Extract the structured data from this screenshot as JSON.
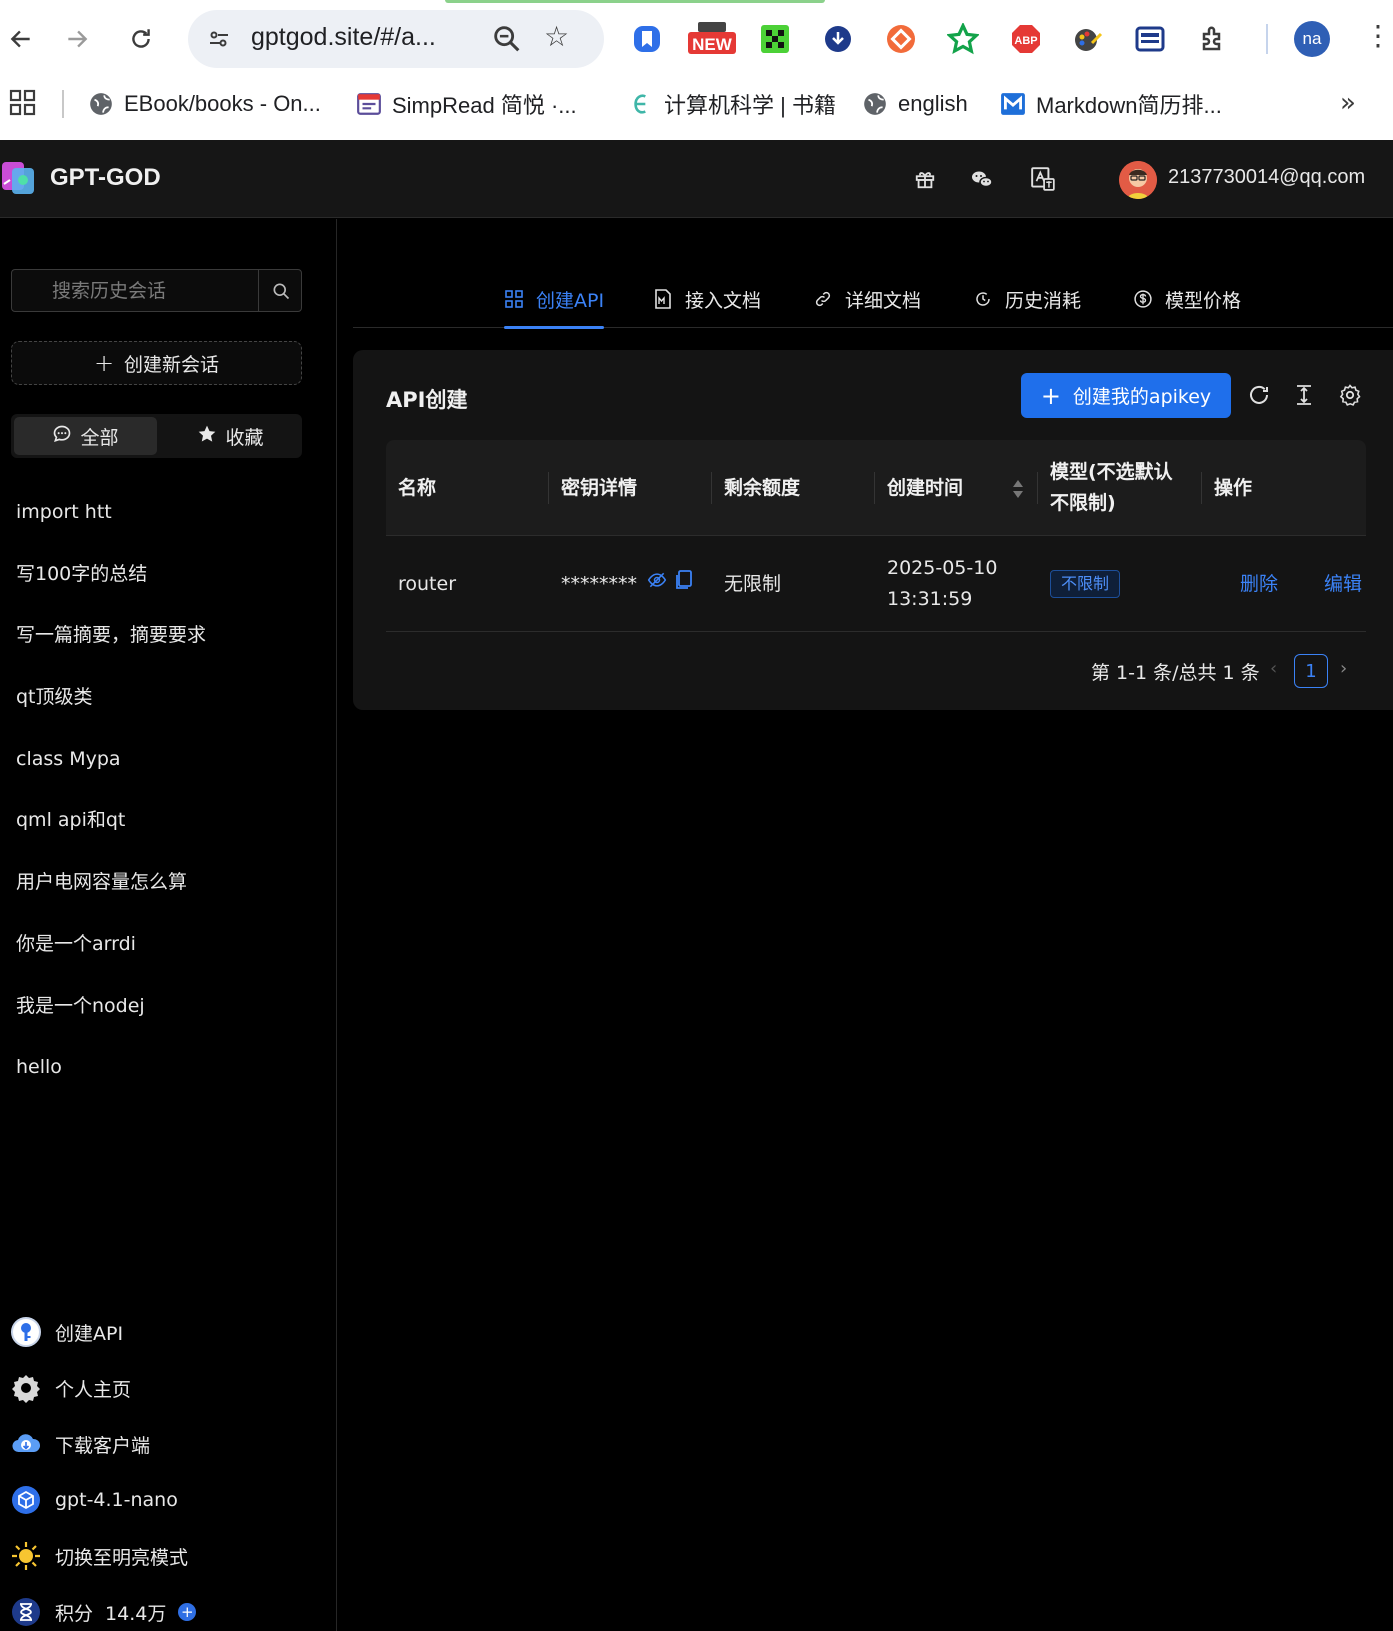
{
  "browser": {
    "url": "gptgod.site/#/a...",
    "profile_initials": "na",
    "new_badge": "NEW",
    "abp_badge": "ABP",
    "bookmarks": [
      {
        "label": "EBook/books - On..."
      },
      {
        "label": "SimpRead 简悦 ·..."
      },
      {
        "label": "计算机科学 | 书籍"
      },
      {
        "label": "english"
      },
      {
        "label": "Markdown简历排..."
      }
    ]
  },
  "header": {
    "brand": "GPT-GOD",
    "user_email": "2137730014@qq.com"
  },
  "sidebar": {
    "search_placeholder": "搜索历史会话",
    "new_chat": "创建新会话",
    "seg_all": "全部",
    "seg_fav": "收藏",
    "history": [
      "import htt",
      "写100字的总结",
      "写一篇摘要，摘要要求",
      "qt顶级类",
      "class Mypa",
      "qml api和qt",
      "用户电网容量怎么算",
      "你是一个arrdi",
      "我是一个nodej",
      "hello"
    ],
    "menu": {
      "create_api": "创建API",
      "profile": "个人主页",
      "download": "下载客户端",
      "model": "gpt-4.1-nano",
      "theme": "切换至明亮模式",
      "points_label": "积分",
      "points_value": "14.4万"
    }
  },
  "tabs": {
    "create_api": "创建API",
    "access_doc": "接入文档",
    "detail_doc": "详细文档",
    "history_usage": "历史消耗",
    "model_price": "模型价格"
  },
  "card": {
    "title": "API创建",
    "create_button": "创建我的apikey",
    "columns": {
      "name": "名称",
      "key": "密钥详情",
      "quota": "剩余额度",
      "created": "创建时间",
      "model_line1": "模型(不选默认",
      "model_line2": "不限制)",
      "actions": "操作"
    },
    "rows": [
      {
        "name": "router",
        "key": "********",
        "quota": "无限制",
        "date": "2025-05-10",
        "time": "13:31:59",
        "model_tag": "不限制",
        "delete": "删除",
        "edit": "编辑"
      }
    ],
    "pagination": {
      "total_text": "第 1-1 条/总共 1 条",
      "current_page": "1"
    }
  },
  "colors": {
    "accent": "#3b82f6",
    "primary_button": "#1f6feb",
    "background": "#000000",
    "card": "#141414",
    "header": "#161616"
  }
}
